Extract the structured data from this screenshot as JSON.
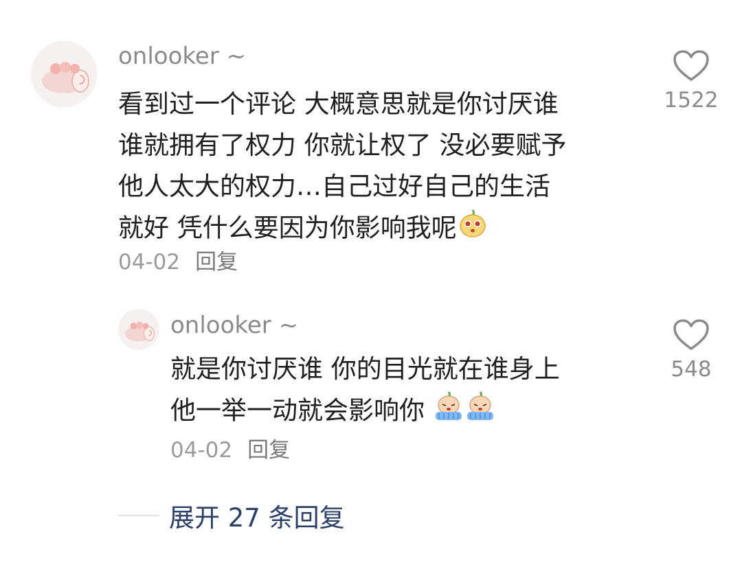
{
  "comments": [
    {
      "username": "onlooker ~",
      "lines": [
        "看到过一个评论 大概意思就是你讨厌谁",
        "谁就拥有了权力 你就让权了 没必要赋予",
        "他人太大的权力…自己过好自己的生活",
        "就好 凭什么要因为你影响我呢"
      ],
      "emoji": "pear-face-emoji",
      "date": "04-02",
      "reply_label": "回复",
      "like_count": "1522"
    },
    {
      "username": "onlooker ~",
      "lines": [
        "就是你讨厌谁 你的目光就在谁身上",
        "他一举一动就会影响你"
      ],
      "emoji": "crying-emoji",
      "date": "04-02",
      "reply_label": "回复",
      "like_count": "548"
    }
  ],
  "expand_label": "展开 27 条回复",
  "colors": {
    "link": "#2b3f66",
    "muted": "#8a8a8a",
    "text": "#1f1f1f"
  }
}
